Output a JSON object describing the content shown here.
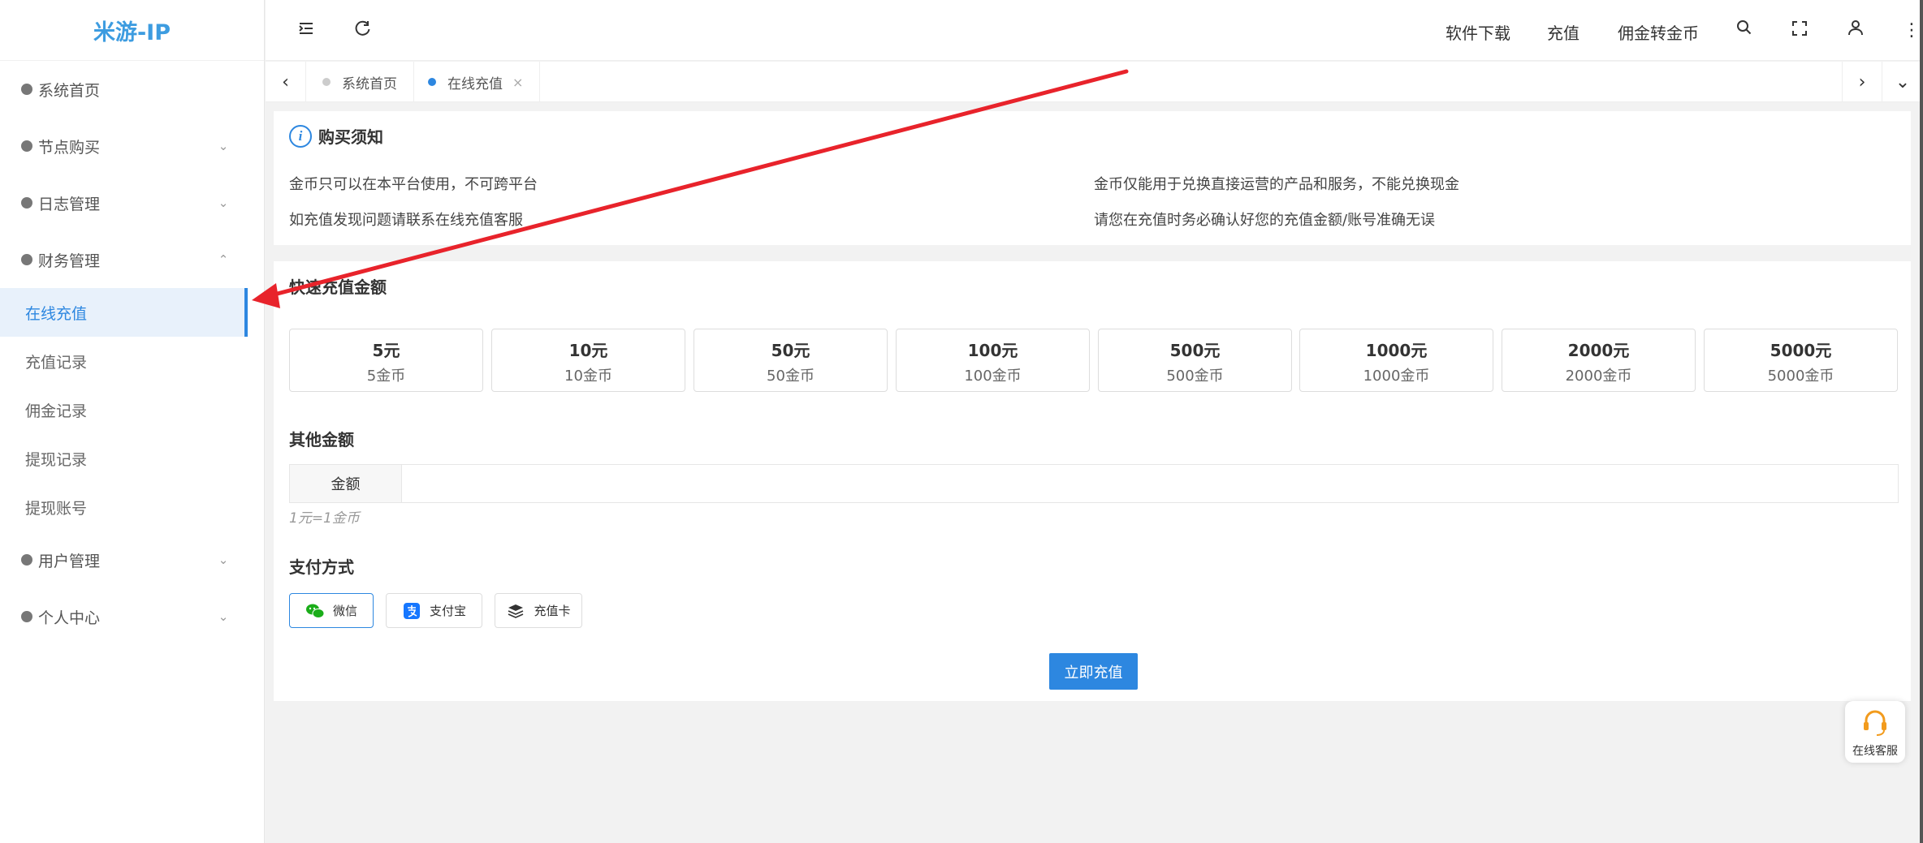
{
  "sidebar": {
    "logo": "米游-IP",
    "groups": [
      {
        "label": "系统首页"
      },
      {
        "label": "节点购买",
        "chevron": "⌄"
      },
      {
        "label": "日志管理",
        "chevron": "⌄"
      },
      {
        "label": "财务管理",
        "chevron": "⌃"
      }
    ],
    "finance_items": [
      {
        "label": "在线充值"
      },
      {
        "label": "充值记录"
      },
      {
        "label": "佣金记录"
      },
      {
        "label": "提现记录"
      },
      {
        "label": "提现账号"
      }
    ],
    "groups_after": [
      {
        "label": "用户管理",
        "chevron": "⌄"
      },
      {
        "label": "个人中心",
        "chevron": "⌄"
      }
    ]
  },
  "topbar": {
    "links": {
      "download": "软件下载",
      "recharge": "充值",
      "commission": "佣金转金币"
    },
    "icons": [
      "menu-fold-icon",
      "refresh-icon",
      "search-icon",
      "fullscreen-icon",
      "user-icon",
      "more-icon"
    ]
  },
  "tabs": {
    "items": [
      {
        "label": "系统首页",
        "active": false
      },
      {
        "label": "在线充值",
        "active": true,
        "close": "×"
      }
    ]
  },
  "notice": {
    "title": "购买须知",
    "lines": [
      "金币只可以在本平台使用，不可跨平台",
      "金币仅能用于兑换直接运营的产品和服务，不能兑换现金",
      "如充值发现问题请联系在线充值客服",
      "请您在充值时务必确认好您的充值金额/账号准确无误"
    ]
  },
  "quick": {
    "title": "快速充值金额",
    "options": [
      {
        "yuan": "5元",
        "coin": "5金币"
      },
      {
        "yuan": "10元",
        "coin": "10金币"
      },
      {
        "yuan": "50元",
        "coin": "50金币"
      },
      {
        "yuan": "100元",
        "coin": "100金币"
      },
      {
        "yuan": "500元",
        "coin": "500金币"
      },
      {
        "yuan": "1000元",
        "coin": "1000金币"
      },
      {
        "yuan": "2000元",
        "coin": "2000金币"
      },
      {
        "yuan": "5000元",
        "coin": "5000金币"
      }
    ]
  },
  "other": {
    "title": "其他金额",
    "label": "金额",
    "value": "",
    "placeholder": "",
    "hint": "1元=1金币"
  },
  "payment": {
    "title": "支付方式",
    "methods": [
      {
        "label": "微信",
        "icon": "wechat-icon",
        "selected": true
      },
      {
        "label": "支付宝",
        "icon": "alipay-icon",
        "selected": false
      },
      {
        "label": "充值卡",
        "icon": "card-icon",
        "selected": false
      }
    ],
    "submit": "立即充值"
  },
  "support": {
    "label": "在线客服",
    "icon": "headset-icon"
  },
  "colors": {
    "accent": "#2d87e0",
    "logo": "#3d9ce0",
    "annotation_arrow": "#e8232b",
    "wechat": "#1aad19",
    "alipay": "#1677ff",
    "support_icon": "#f29b1d"
  }
}
